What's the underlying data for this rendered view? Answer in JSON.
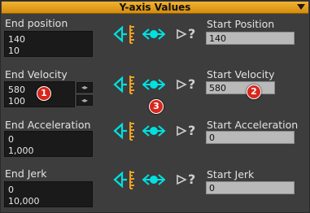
{
  "window": {
    "title": "Y-axis Values"
  },
  "rows": [
    {
      "end_label": "End position",
      "end_line1": "140",
      "end_line2": "10",
      "start_label": "Start Position",
      "start_value": "140"
    },
    {
      "end_label": "End Velocity",
      "end_line1": "580",
      "end_line2": "100",
      "start_label": "Start Velocity",
      "start_value": "580"
    },
    {
      "end_label": "End Acceleration",
      "end_line1": "0",
      "end_line2": "1,000",
      "start_label": "Start Acceleration",
      "start_value": "0"
    },
    {
      "end_label": "End Jerk",
      "end_line1": "0",
      "end_line2": "10,000",
      "start_label": "Start Jerk",
      "start_value": "0"
    }
  ],
  "badges": [
    "1",
    "2",
    "3"
  ],
  "icons": {
    "left": "arrow-into-ruler-icon",
    "middle": "double-arrow-icon",
    "right": "question-arrow-icon",
    "question_text": "?",
    "accent": "#00e0e0",
    "ruler": "#f0a020"
  },
  "spinner_glyph": "◂▸"
}
